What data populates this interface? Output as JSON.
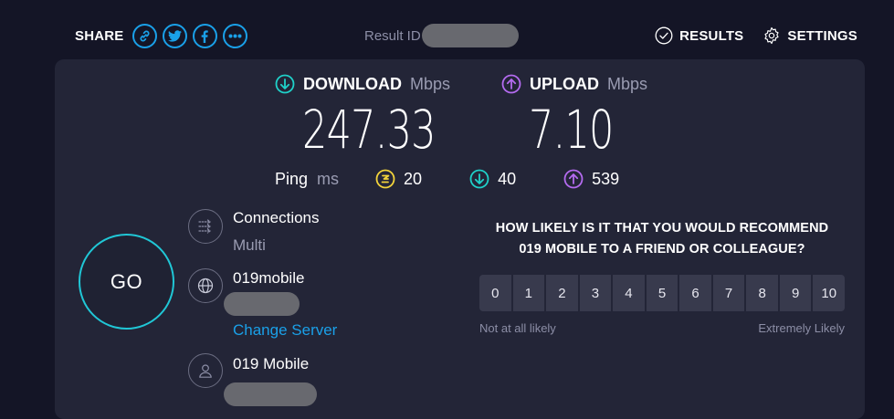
{
  "header": {
    "share_label": "SHARE",
    "share_buttons": [
      {
        "icon": "link-icon"
      },
      {
        "icon": "twitter-icon"
      },
      {
        "icon": "facebook-icon"
      },
      {
        "icon": "more-icon"
      }
    ],
    "result_id_label": "Result ID",
    "results_label": "RESULTS",
    "settings_label": "SETTINGS"
  },
  "download": {
    "label": "DOWNLOAD",
    "unit": "Mbps",
    "value": "247.33",
    "color": "#1fd1c9"
  },
  "upload": {
    "label": "UPLOAD",
    "unit": "Mbps",
    "value": "7.10",
    "color": "#b46bf0"
  },
  "ping": {
    "label": "Ping",
    "unit": "ms",
    "idle": "20",
    "download": "40",
    "upload": "539",
    "idle_color": "#f3d43b"
  },
  "go_label": "GO",
  "connections": {
    "label": "Connections",
    "value": "Multi"
  },
  "server": {
    "name": "019mobile",
    "change_label": "Change Server"
  },
  "provider": {
    "name": "019 Mobile"
  },
  "survey": {
    "question_line1": "HOW LIKELY IS IT THAT YOU WOULD RECOMMEND",
    "question_line2": "019 MOBILE TO A FRIEND OR COLLEAGUE?",
    "scale": [
      "0",
      "1",
      "2",
      "3",
      "4",
      "5",
      "6",
      "7",
      "8",
      "9",
      "10"
    ],
    "low_label": "Not at all likely",
    "high_label": "Extremely Likely"
  },
  "colors": {
    "accent": "#1aa0e8",
    "background": "#141526",
    "panel": "#232537",
    "go_ring": "#20c7d6"
  }
}
